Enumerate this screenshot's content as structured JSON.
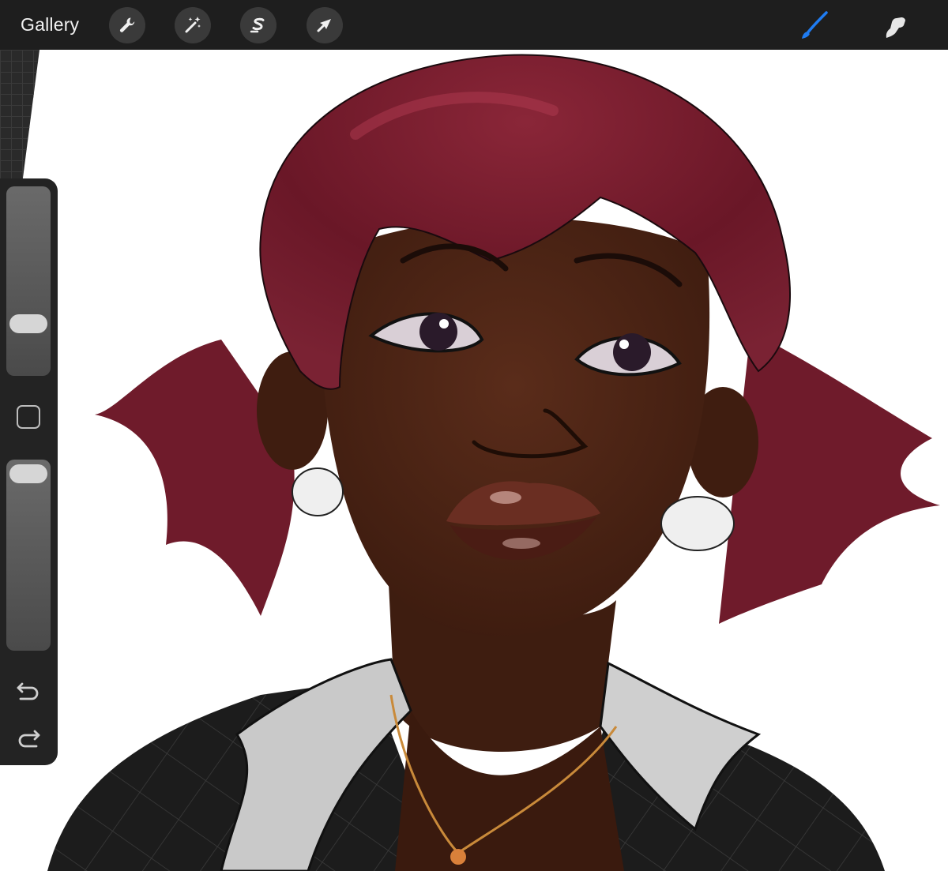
{
  "app": {
    "gallery_label": "Gallery"
  },
  "toolbar": {
    "left_tools": [
      "wrench-icon",
      "magic-wand-icon",
      "selection-s-icon",
      "transform-arrow-icon"
    ],
    "right_tools": [
      "brush-icon",
      "smudge-icon"
    ],
    "active_tool": "brush-icon",
    "accent_color": "#1f7cf2"
  },
  "sidebar": {
    "brush_size_level": 0.48,
    "opacity_level": 0.93,
    "tools": [
      "modify-square-icon",
      "undo-icon",
      "redo-icon"
    ]
  },
  "colors": {
    "toolbar_bg": "#1e1e1e",
    "sidebar_bg": "#232323",
    "canvas_bg": "#ffffff",
    "hair": "#6e1a2a",
    "skin": "#4a2215"
  }
}
